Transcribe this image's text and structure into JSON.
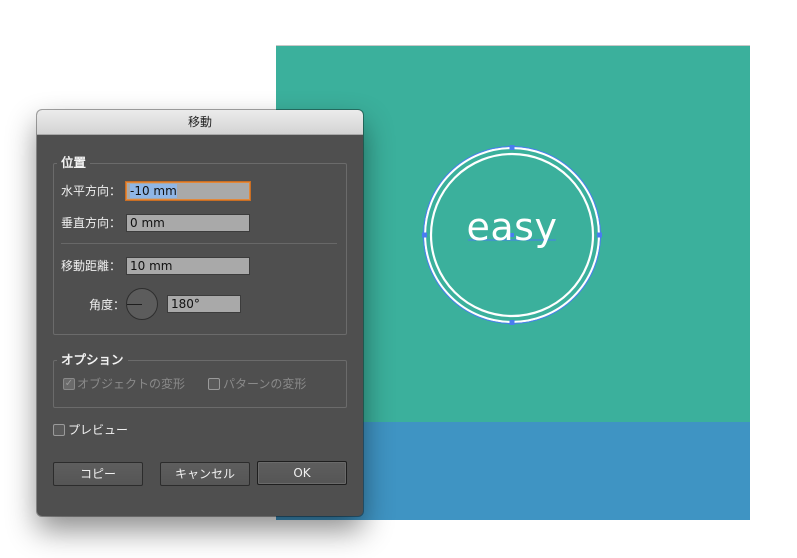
{
  "dialog": {
    "title": "移動",
    "position_group": {
      "title": "位置",
      "horizontal_label": "水平方向：",
      "horizontal_value": "-10 mm",
      "vertical_label": "垂直方向：",
      "vertical_value": "0 mm",
      "distance_label": "移動距離：",
      "distance_value": "10 mm",
      "angle_label": "角度：",
      "angle_value": "180°"
    },
    "options_group": {
      "title": "オプション",
      "transform_objects_label": "オブジェクトの変形",
      "transform_objects_checked": true,
      "transform_patterns_label": "パターンの変形",
      "transform_patterns_checked": false
    },
    "preview": {
      "label": "プレビュー",
      "checked": false
    },
    "buttons": {
      "copy": "コピー",
      "cancel": "キャンセル",
      "ok": "OK"
    }
  },
  "canvas": {
    "text": "easy",
    "colors": {
      "teal": "#3bb09c",
      "blue": "#3f94c3",
      "selection": "#4a7df0"
    }
  }
}
